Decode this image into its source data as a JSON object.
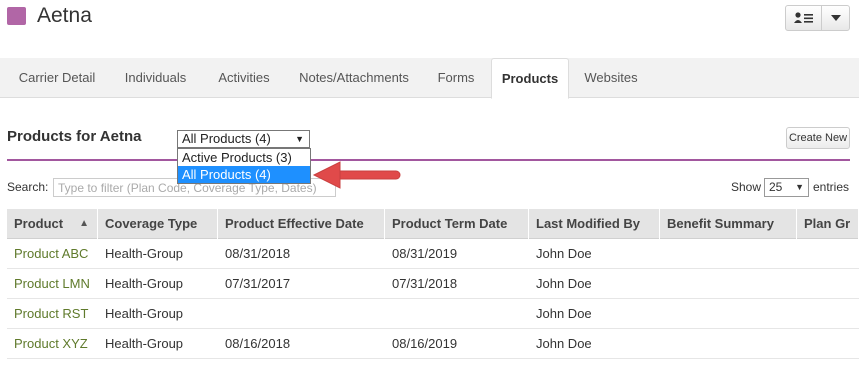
{
  "header": {
    "carrier_name": "Aetna",
    "carrier_color": "#b166a6"
  },
  "tabs": [
    {
      "label": "Carrier Detail",
      "active": false
    },
    {
      "label": "Individuals",
      "active": false
    },
    {
      "label": "Activities",
      "active": false
    },
    {
      "label": "Notes/Attachments",
      "active": false
    },
    {
      "label": "Forms",
      "active": false
    },
    {
      "label": "Products",
      "active": true
    },
    {
      "label": "Websites",
      "active": false
    }
  ],
  "products_section": {
    "title": "Products for Aetna",
    "filter_selected": "All Products (4)",
    "filter_options": [
      "Active Products (3)",
      "All Products (4)"
    ],
    "create_button": "Create New"
  },
  "search": {
    "label": "Search:",
    "placeholder": "Type to filter (Plan Code, Coverage Type, Dates)",
    "show_label": "Show",
    "page_size": "25",
    "entries_label": "entries"
  },
  "table": {
    "columns": [
      "Product",
      "Coverage Type",
      "Product Effective Date",
      "Product Term Date",
      "Last Modified By",
      "Benefit Summary",
      "Plan Gr"
    ],
    "rows": [
      [
        "Product ABC",
        "Health-Group",
        "08/31/2018",
        "08/31/2019",
        "John Doe",
        "",
        ""
      ],
      [
        "Product LMN",
        "Health-Group",
        "07/31/2017",
        "07/31/2018",
        "John Doe",
        "",
        ""
      ],
      [
        "Product RST",
        "Health-Group",
        "",
        "",
        "John Doe",
        "",
        ""
      ],
      [
        "Product XYZ",
        "Health-Group",
        "08/16/2018",
        "08/16/2019",
        "John Doe",
        "",
        ""
      ]
    ]
  },
  "colors": {
    "accent_purple": "#a2579e",
    "link_green": "#5f7a2b",
    "selected_blue": "#1e90ff",
    "arrow_red": "#e04a4a"
  }
}
